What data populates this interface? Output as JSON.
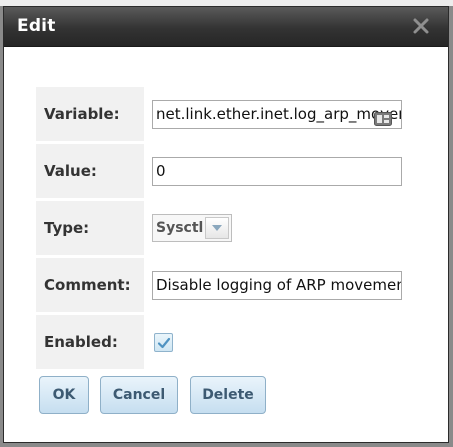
{
  "dialog": {
    "title": "Edit",
    "close_icon": "close-x-icon"
  },
  "form": {
    "variable": {
      "label": "Variable:",
      "value": "net.link.ether.inet.log_arp_movements"
    },
    "value_field": {
      "label": "Value:",
      "value": "0"
    },
    "type": {
      "label": "Type:",
      "selected": "Sysctl"
    },
    "comment": {
      "label": "Comment:",
      "value": "Disable logging of ARP movements"
    },
    "enabled": {
      "label": "Enabled:",
      "checked": true
    }
  },
  "buttons": {
    "ok": "OK",
    "cancel": "Cancel",
    "delete": "Delete"
  },
  "colors": {
    "titlebar": "#333333",
    "label_bg": "#f1f1f1",
    "button_text": "#3d5a72"
  }
}
